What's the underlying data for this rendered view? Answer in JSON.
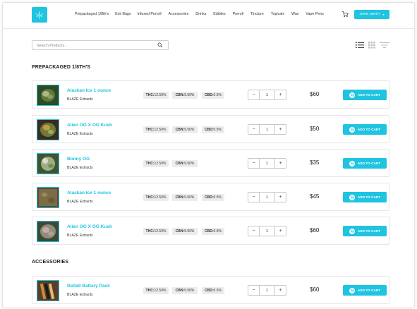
{
  "nav": {
    "items": [
      "Prepackaged 1/8th's",
      "Exit Bags",
      "Infused Preroll",
      "Accessories",
      "Drinks",
      "Edibles",
      "Preroll",
      "Tincture",
      "Topicals",
      "Wax",
      "Vape Pens"
    ],
    "user_label": "JOHN SMITH"
  },
  "search": {
    "placeholder": "Search Products..."
  },
  "sections": [
    {
      "title": "PREPACKAGED 1/8TH'S"
    },
    {
      "title": "ACCESSORIES"
    }
  ],
  "products": [
    {
      "name": "Alaskan Ice 1 ounce",
      "brand": "BLAZE Extracts",
      "thc": "12.50%",
      "cbn": "9.50%",
      "cbd": "0.5%",
      "qty": "1",
      "price": "$60",
      "button": "ADD TO CART"
    },
    {
      "name": "Alien OG X OG Kush",
      "brand": "BLAZE Extracts",
      "thc": "12.50%",
      "cbn": "9.50%",
      "cbd": "0.5%",
      "qty": "1",
      "price": "$50",
      "button": "ADD TO CART"
    },
    {
      "name": "Bonny OG",
      "brand": "BLAZE Extracts",
      "thc": "12.50%",
      "cbn": "9.50%",
      "qty": "1",
      "price": "$35",
      "button": "ADD TO CART"
    },
    {
      "name": "Alaskan Ice 1 ounce",
      "brand": "BLAZE Extracts",
      "thc": "12.50%",
      "cbn": "9.50%",
      "cbd": "0.5%",
      "qty": "1",
      "price": "$45",
      "button": "ADD TO CART"
    },
    {
      "name": "Alien OG X OG Kush",
      "brand": "BLAZE Extracts",
      "thc": "12.50%",
      "cbn": "9.50%",
      "cbd": "0.5%",
      "qty": "1",
      "price": "$60",
      "button": "ADD TO CART"
    },
    {
      "name": "Delta9 Battery Pack",
      "brand": "BLAZE Extracts",
      "thc": "12.50%",
      "cbn": "9.50%",
      "cbd": "0.5%",
      "qty": "1",
      "price": "$60",
      "button": "ADD TO CART"
    }
  ],
  "labels": {
    "thc": "THC:",
    "cbn": "CBN:",
    "cbd": "CBD:"
  },
  "colors": {
    "accent": "#1fc4e0"
  }
}
